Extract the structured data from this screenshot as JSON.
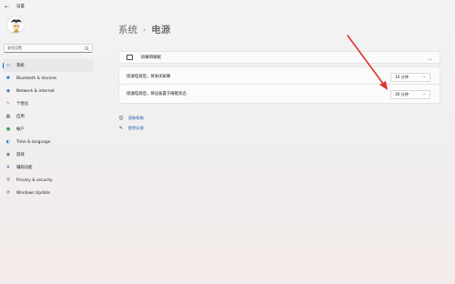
{
  "window": {
    "back_glyph": "←",
    "title": "设置"
  },
  "search": {
    "placeholder": "查找设置"
  },
  "nav": [
    {
      "label": "系统",
      "icon": "monitor-icon",
      "icon_glyph": "▭",
      "icon_color": "#0067c0",
      "active": true
    },
    {
      "label": "Bluetooth & devices",
      "icon": "bluetooth-icon",
      "icon_glyph": "✱",
      "icon_color": "#0b6bd3",
      "active": false
    },
    {
      "label": "Network & internet",
      "icon": "wifi-icon",
      "icon_glyph": "◆",
      "icon_color": "#2b6fb8",
      "active": false
    },
    {
      "label": "个性化",
      "icon": "brush-icon",
      "icon_glyph": "✎",
      "icon_color": "#d9823b",
      "active": false
    },
    {
      "label": "应用",
      "icon": "apps-icon",
      "icon_glyph": "▦",
      "icon_color": "#4a5a6a",
      "active": false
    },
    {
      "label": "帐户",
      "icon": "person-icon",
      "icon_glyph": "●",
      "icon_color": "#2aa15b",
      "active": false
    },
    {
      "label": "Time & language",
      "icon": "globe-clock-icon",
      "icon_glyph": "◐",
      "icon_color": "#1f7fc4",
      "active": false
    },
    {
      "label": "游戏",
      "icon": "gamepad-icon",
      "icon_glyph": "◉",
      "icon_color": "#6a6a6a",
      "active": false
    },
    {
      "label": "辅助功能",
      "icon": "accessibility-icon",
      "icon_glyph": "✦",
      "icon_color": "#1f5fa8",
      "active": false
    },
    {
      "label": "Privacy & security",
      "icon": "shield-icon",
      "icon_glyph": "⛨",
      "icon_color": "#6b6b6b",
      "active": false
    },
    {
      "label": "Windows Update",
      "icon": "update-icon",
      "icon_glyph": "⟳",
      "icon_color": "#0067c0",
      "active": false
    }
  ],
  "main": {
    "breadcrumb": "系统",
    "separator": "›",
    "title": "电源",
    "section": {
      "label": "屏幕和睡眠",
      "icon": "screen-icon",
      "chevron": "︿"
    },
    "rows": [
      {
        "label": "接通电源后，将关闭屏幕",
        "value": "10 分钟"
      },
      {
        "label": "接通电源后，将设备置于睡眠状态",
        "value": "30 分钟"
      }
    ],
    "links": [
      {
        "label": "获取帮助",
        "icon": "help-icon",
        "glyph": "☺"
      },
      {
        "label": "提供反馈",
        "icon": "feedback-icon",
        "glyph": "✎"
      }
    ]
  },
  "colors": {
    "accent": "#0067c0",
    "arrow": "#e0352b"
  }
}
